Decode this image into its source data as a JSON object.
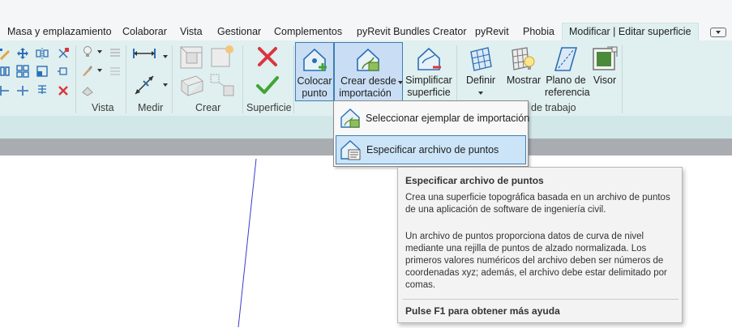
{
  "tabs": [
    {
      "label": "Masa y emplazamiento"
    },
    {
      "label": "Colaborar"
    },
    {
      "label": "Vista"
    },
    {
      "label": "Gestionar"
    },
    {
      "label": "Complementos"
    },
    {
      "label": "pyRevit Bundles Creator"
    },
    {
      "label": "pyRevit"
    },
    {
      "label": "Phobia"
    },
    {
      "label": "Modificar | Editar superficie",
      "active": true
    }
  ],
  "panels": {
    "vista": "Vista",
    "medir": "Medir",
    "crear": "Crear",
    "superficie": "Superficie",
    "trabajo": "de trabajo"
  },
  "buttons": {
    "colocar": {
      "line1": "Colocar",
      "line2": "punto"
    },
    "crear_desde": {
      "line1": "Crear desde",
      "line2": "importación"
    },
    "simplificar": {
      "line1": "Simplificar",
      "line2": "superficie"
    },
    "definir": {
      "line1": "Definir"
    },
    "mostrar": {
      "line1": "Mostrar"
    },
    "plano": {
      "line1": "Plano de",
      "line2": "referencia"
    },
    "visor": {
      "line1": "Visor"
    }
  },
  "dropdown": {
    "items": [
      {
        "label": "Seleccionar ejemplar de importación"
      },
      {
        "label": "Especificar archivo de puntos",
        "selected": true
      }
    ]
  },
  "tooltip": {
    "title": "Especificar archivo de puntos",
    "p1": "Crea una superficie topográfica basada en un archivo de puntos de una aplicación de software de ingeniería civil.",
    "p2": "Un archivo de puntos proporciona datos de curva de nivel mediante una rejilla de puntos de alzado normalizada. Los primeros valores numéricos del archivo deben ser números de coordenadas xyz; además, el archivo debe estar delimitado por comas.",
    "help": "Pulse F1 para obtener más ayuda"
  },
  "colors": {
    "ribbon": "#e0efef",
    "highlight": "#c9def4",
    "highlight_border": "#3c7fb1",
    "accept_green": "#3fa535",
    "cancel_red": "#d9363e"
  }
}
